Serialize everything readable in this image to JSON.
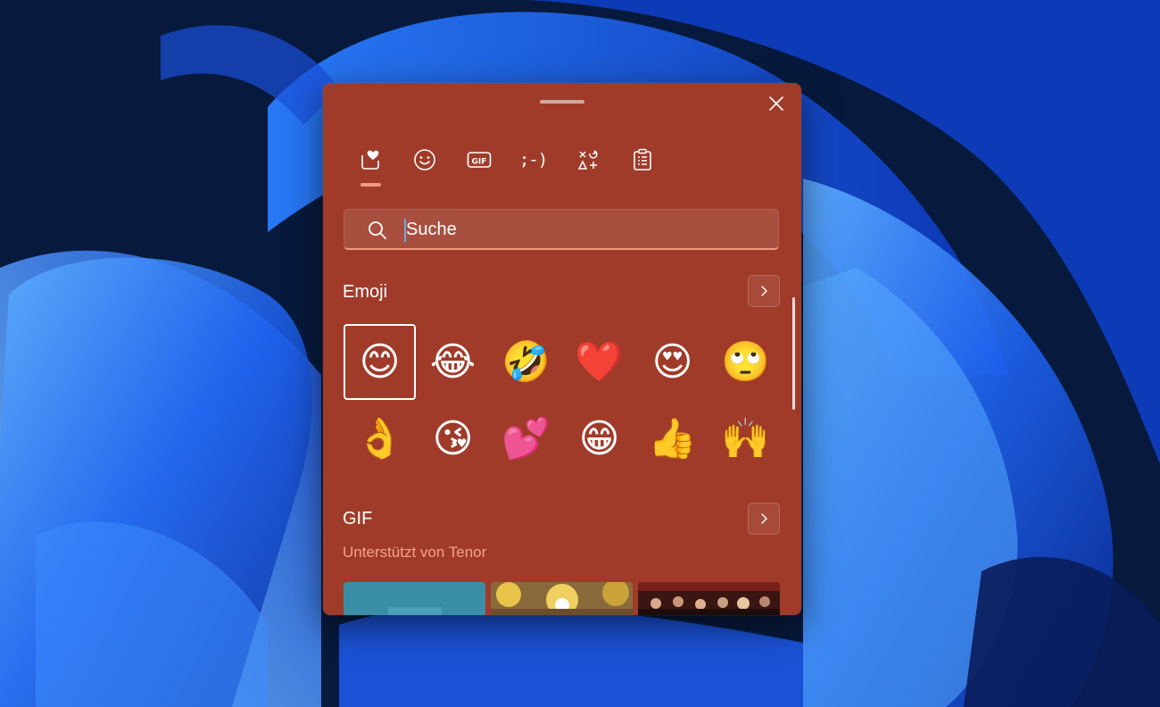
{
  "colors": {
    "panel_bg": "#a03b2a",
    "accent": "#f39a80",
    "subtitle": "#f3a38d"
  },
  "tabs": [
    {
      "name": "tab-favorites",
      "icon": "heart-icon",
      "active": true
    },
    {
      "name": "tab-emoji",
      "icon": "smiley-icon",
      "active": false
    },
    {
      "name": "tab-gif",
      "icon": "gif-icon",
      "label": "GIF",
      "active": false
    },
    {
      "name": "tab-kaomoji",
      "icon": "kaomoji-icon",
      "label": ";-)",
      "active": false
    },
    {
      "name": "tab-symbols",
      "icon": "symbols-icon",
      "active": false
    },
    {
      "name": "tab-clipboard",
      "icon": "clipboard-icon",
      "active": false
    }
  ],
  "search": {
    "placeholder": "Suche",
    "value": ""
  },
  "emoji_section": {
    "title": "Emoji",
    "items": [
      "😊",
      "😂",
      "🤣",
      "❤️",
      "😍",
      "🙄",
      "👌",
      "😘",
      "💕",
      "😁",
      "👍",
      "🙌"
    ],
    "selected_index": 0
  },
  "gif_section": {
    "title": "GIF",
    "subtitle": "Unterstützt von Tenor",
    "thumbnails": [
      "gif-thumb-1",
      "gif-thumb-2",
      "gif-thumb-3"
    ]
  }
}
